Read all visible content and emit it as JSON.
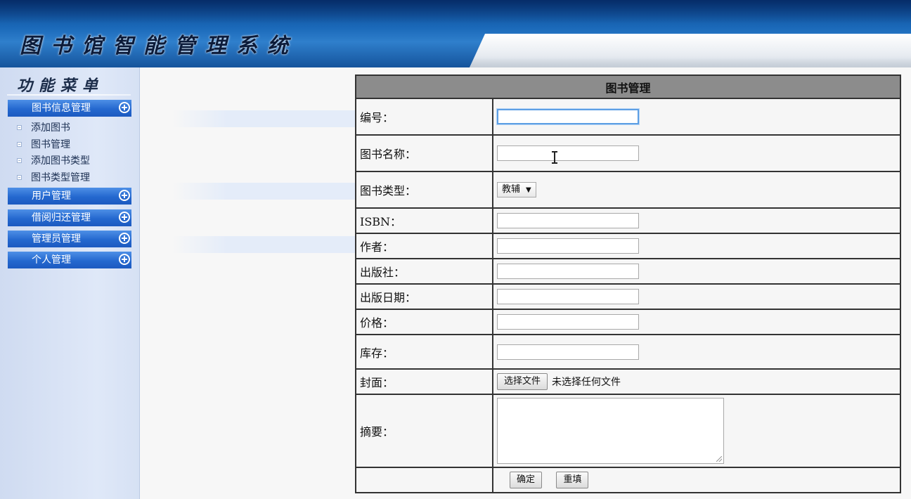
{
  "header": {
    "app_title": "图书馆智能管理系统"
  },
  "sidebar": {
    "title": "功能菜单",
    "groups": [
      {
        "label": "图书信息管理",
        "items": [
          "添加图书",
          "图书管理",
          "添加图书类型",
          "图书类型管理"
        ]
      },
      {
        "label": "用户管理"
      },
      {
        "label": "借阅归还管理"
      },
      {
        "label": "管理员管理"
      },
      {
        "label": "个人管理"
      }
    ]
  },
  "form": {
    "title": "图书管理",
    "fields": {
      "id": {
        "label": "编号：",
        "value": ""
      },
      "name": {
        "label": "图书名称：",
        "value": ""
      },
      "type": {
        "label": "图书类型：",
        "selected": "教辅"
      },
      "isbn": {
        "label": "ISBN：",
        "value": ""
      },
      "author": {
        "label": "作者：",
        "value": ""
      },
      "publisher": {
        "label": "出版社：",
        "value": ""
      },
      "pub_date": {
        "label": "出版日期：",
        "value": ""
      },
      "price": {
        "label": "价格：",
        "value": ""
      },
      "stock": {
        "label": "库存：",
        "value": ""
      },
      "cover": {
        "label": "封面：",
        "button": "选择文件",
        "status": "未选择任何文件"
      },
      "summary": {
        "label": "摘要：",
        "value": ""
      }
    },
    "submit_label": "确定",
    "reset_label": "重填"
  }
}
